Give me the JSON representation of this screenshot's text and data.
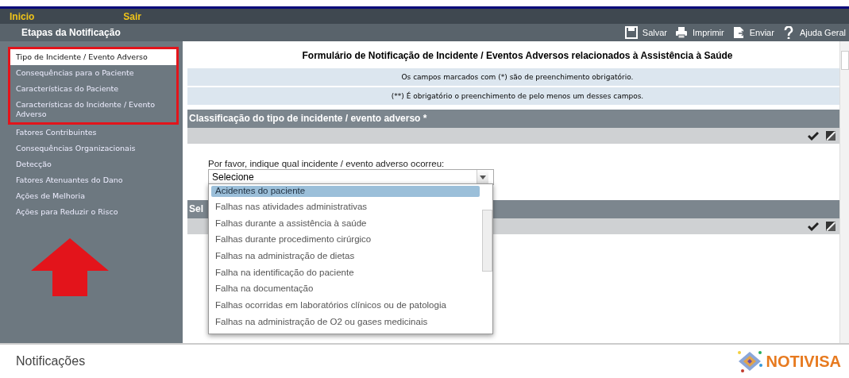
{
  "top_nav": {
    "links": [
      "Inicio",
      "Sair"
    ]
  },
  "header": {
    "title": "Etapas da Notificação",
    "actions": [
      {
        "label": "Salvar",
        "kind": "save"
      },
      {
        "label": "Imprimir",
        "kind": "print"
      },
      {
        "label": "Enviar",
        "kind": "send"
      },
      {
        "label": "Ajuda Geral",
        "kind": "help"
      }
    ]
  },
  "sidebar": {
    "items": [
      {
        "label": "Tipo de Incidente / Evento Adverso",
        "selected": true,
        "highlighted": true
      },
      {
        "label": "Consequências para o Paciente",
        "selected": false,
        "highlighted": true
      },
      {
        "label": "Características do Paciente",
        "selected": false,
        "highlighted": true
      },
      {
        "label": "Características do Incidente / Evento Adverso",
        "selected": false,
        "highlighted": true
      },
      {
        "label": "Fatores Contribuintes",
        "selected": false,
        "highlighted": false
      },
      {
        "label": "Consequências Organizacionais",
        "selected": false,
        "highlighted": false
      },
      {
        "label": "Detecção",
        "selected": false,
        "highlighted": false
      },
      {
        "label": "Fatores Atenuantes do Dano",
        "selected": false,
        "highlighted": false
      },
      {
        "label": "Ações de Melhoria",
        "selected": false,
        "highlighted": false
      },
      {
        "label": "Ações para Reduzir o Risco",
        "selected": false,
        "highlighted": false
      }
    ]
  },
  "form": {
    "title": "Formulário de Notificação de Incidente / Eventos Adversos relacionados à Assistência à Saúde",
    "notes": [
      "Os campos marcados com (*) são de preenchimento obrigatório.",
      "(**) É obrigatório o preenchimento de pelo menos um desses campos."
    ],
    "sections": [
      {
        "title": "Classificação do tipo de incidente / evento adverso *",
        "question": "Por favor, indique qual incidente / evento adverso ocorreu:",
        "select": {
          "value": "Selecione",
          "expanded": true,
          "options": [
            {
              "label": "Acidentes do paciente",
              "selected": true
            },
            {
              "label": "Falhas nas atividades administrativas",
              "selected": false
            },
            {
              "label": "Falhas durante a assistência à saúde",
              "selected": false
            },
            {
              "label": "Falhas durante procedimento cirúrgico",
              "selected": false
            },
            {
              "label": "Falhas na administração de dietas",
              "selected": false
            },
            {
              "label": "Falha na identificação do paciente",
              "selected": false
            },
            {
              "label": "Falha na documentação",
              "selected": false
            },
            {
              "label": "Falhas ocorridas em laboratórios clínicos ou de patologia",
              "selected": false
            },
            {
              "label": "Falhas na administração de O2 ou gases medicinais",
              "selected": false
            }
          ]
        }
      },
      {
        "title": "Sel"
      }
    ]
  },
  "footer": {
    "title": "Notificações",
    "logo": "NOTIVISA"
  }
}
